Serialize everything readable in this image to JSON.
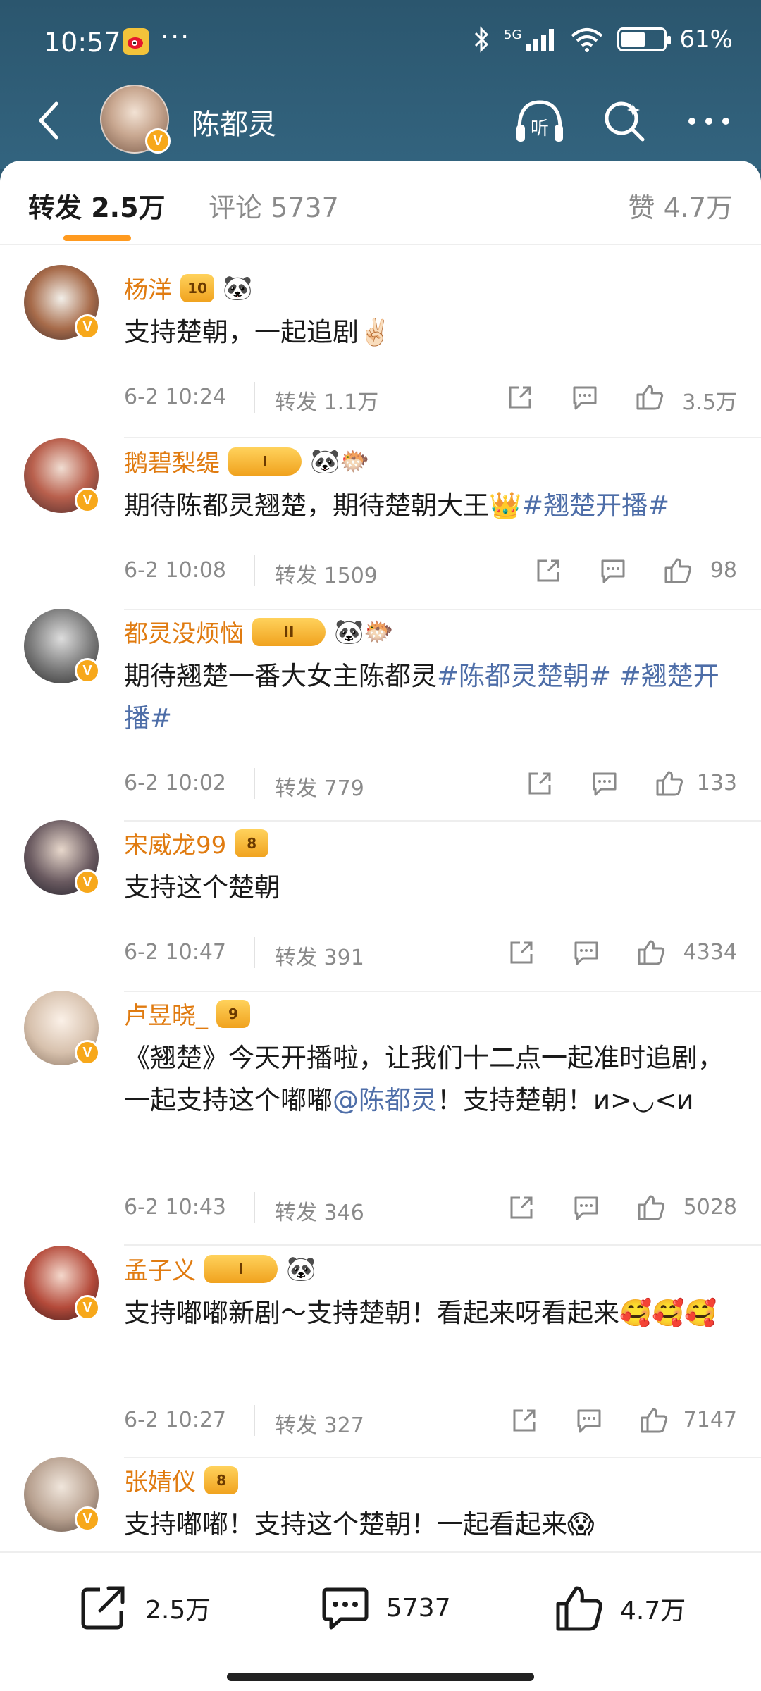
{
  "status_bar": {
    "time": "10:57",
    "dots": "···",
    "network": "5G",
    "battery_text": "61%",
    "battery_level": 0.61
  },
  "nav": {
    "title": "陈都灵",
    "listen_label": "听"
  },
  "tabs": [
    {
      "label": "转发 2.5万"
    },
    {
      "label": "评论 5737"
    },
    {
      "label": "赞 4.7万"
    }
  ],
  "comments": [
    {
      "name": "杨洋",
      "text": "支持楚朝，一起追剧✌🏻",
      "time": "6-2 10:24",
      "repost": "转发 1.1万",
      "likes": "3.5万",
      "crown_label": "10",
      "extra": "🐼",
      "avatar_color": "#3a2a2a"
    },
    {
      "name": "鹅碧梨缇",
      "text_before": "期待陈都灵翘楚，期待楚朝大王👑",
      "tag": "#翘楚开播#",
      "time": "6-2 10:08",
      "repost": "转发 1509",
      "likes": "98",
      "crown_label": "I",
      "extra": "🐼🐡",
      "avatar_color": "#6a3a3a"
    },
    {
      "name": "都灵没烦恼",
      "text_before": "期待翘楚一番大女主陈都灵",
      "tag": "#陈都灵楚朝# #翘楚开播#",
      "time": "6-2 10:02",
      "repost": "转发 779",
      "likes": "133",
      "crown_label": "II",
      "extra": "🐼🐡",
      "avatar_color": "#555555"
    },
    {
      "name": "宋威龙99",
      "text": "支持这个楚朝",
      "time": "6-2 10:47",
      "repost": "转发 391",
      "likes": "4334",
      "crown_label": "8",
      "avatar_color": "#2a2a35"
    },
    {
      "name": "卢昱晓_",
      "text_before": "《翘楚》今天开播啦，让我们十二点一起准时追剧，一起支持这个嘟嘟",
      "mention": "@陈都灵",
      "text_after": "！支持楚朝！ᴎ>◡<ᴎ",
      "time": "6-2 10:43",
      "repost": "转发 346",
      "likes": "5028",
      "crown_label": "9",
      "avatar_color": "#d9c3b0"
    },
    {
      "name": "孟子义",
      "text": "支持嘟嘟新剧～支持楚朝！看起来呀看起来🥰🥰🥰",
      "time": "6-2 10:27",
      "repost": "转发 327",
      "likes": "7147",
      "crown_label": "I",
      "extra": "🐼",
      "avatar_color": "#8a2a2a"
    },
    {
      "name": "张婧仪",
      "text": "支持嘟嘟！支持这个楚朝！一起看起来😱",
      "crown_label": "8",
      "avatar_color": "#c7b6a6"
    }
  ],
  "bottom_bar": {
    "repost": "2.5万",
    "comment": "5737",
    "like": "4.7万"
  },
  "colors": {
    "header": "#2e5a73",
    "accent": "#ff9a1f",
    "username": "#e07b10",
    "tag": "#4e6ea8",
    "verified": "#f7a81b"
  }
}
